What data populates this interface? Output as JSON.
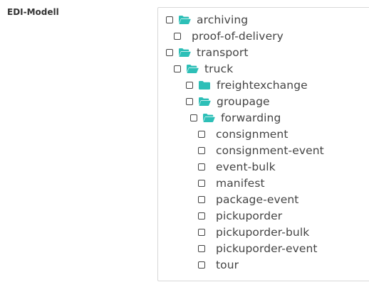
{
  "field": {
    "label": "EDI-Modell"
  },
  "colors": {
    "folder": "#2dbfb7",
    "text": "#444444",
    "border": "#d8d8d8"
  },
  "tree": [
    {
      "label": "archiving",
      "icon": "folder-open-icon",
      "depth": 0
    },
    {
      "label": "proof-of-delivery",
      "icon": null,
      "depth": 1
    },
    {
      "label": "transport",
      "icon": "folder-open-icon",
      "depth": 0
    },
    {
      "label": "truck",
      "icon": "folder-open-icon",
      "depth": 1
    },
    {
      "label": "freightexchange",
      "icon": "folder-closed-icon",
      "depth": 2
    },
    {
      "label": "groupage",
      "icon": "folder-open-icon",
      "depth": 2
    },
    {
      "label": "forwarding",
      "icon": "folder-open-icon",
      "depth": 3
    },
    {
      "label": "consignment",
      "icon": null,
      "depth": 4
    },
    {
      "label": "consignment-event",
      "icon": null,
      "depth": 4
    },
    {
      "label": "event-bulk",
      "icon": null,
      "depth": 4
    },
    {
      "label": "manifest",
      "icon": null,
      "depth": 4
    },
    {
      "label": "package-event",
      "icon": null,
      "depth": 4
    },
    {
      "label": "pickuporder",
      "icon": null,
      "depth": 4
    },
    {
      "label": "pickuporder-bulk",
      "icon": null,
      "depth": 4
    },
    {
      "label": "pickuporder-event",
      "icon": null,
      "depth": 4
    },
    {
      "label": "tour",
      "icon": null,
      "depth": 4
    }
  ]
}
